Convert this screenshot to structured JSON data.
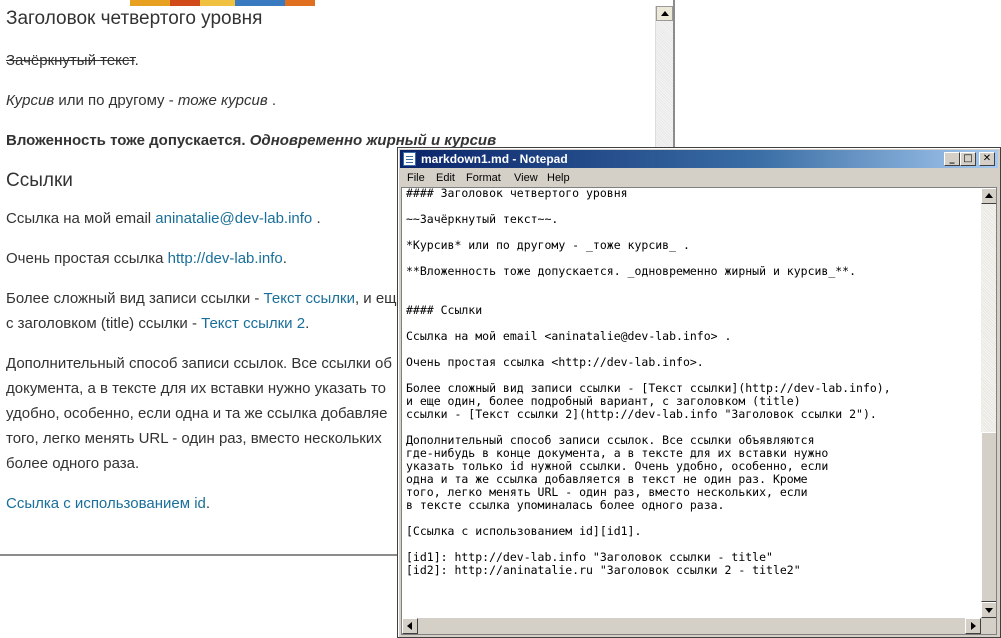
{
  "colors": {
    "link": "#1a6f9a",
    "text": "#333333",
    "titlebar_start": "#0a246a",
    "titlebar_end": "#a6caf0",
    "chrome": "#d4d0c8"
  },
  "preview": {
    "heading_h4": "Заголовок четвертого уровня",
    "strike_text": "Зачёркнутый текст",
    "strike_tail": ".",
    "italic_line": {
      "italic1": "Курсив",
      "middle": " или по другому - ",
      "italic2": "тоже курсив",
      "tail": " ."
    },
    "nested_line": {
      "bold": "Вложенность тоже допускается. ",
      "bold_italic": "Одновременно жирный и курсив"
    },
    "heading_links": "Ссылки",
    "email_line": {
      "prefix": "Ссылка на мой email ",
      "link": "aninatalie@dev-lab.info",
      "tail": " ."
    },
    "simple_link_line": {
      "prefix": "Очень простая ссылка ",
      "link": "http://dev-lab.info",
      "tail": "."
    },
    "complex_line1": {
      "prefix": "Более сложный вид записи ссылки - ",
      "link": "Текст ссылки",
      "tail": ", и ещ"
    },
    "complex_line2": {
      "prefix": "с заголовком (title) ссылки - ",
      "link": "Текст ссылки 2",
      "tail": "."
    },
    "extra_lines": [
      "Дополнительный способ записи ссылок. Все ссылки об",
      "документа, а в тексте для их вставки нужно указать то",
      "удобно, особенно, если одна и та же ссылка добавляе",
      "того, легко менять URL - один раз, вместо нескольких",
      "более одного раза."
    ],
    "id_link_line": {
      "link": "Ссылка с использованием id",
      "tail": "."
    }
  },
  "notepad": {
    "title": "markdown1.md - Notepad",
    "menu": [
      "File",
      "Edit",
      "Format",
      "View",
      "Help"
    ],
    "lines": [
      "#### Заголовок четвертого уровня",
      "",
      "~~Зачёркнутый текст~~.",
      "",
      "*Курсив* или по другому - _тоже курсив_ .",
      "",
      "**Вложенность тоже допускается. _одновременно жирный и курсив_**.",
      "",
      "",
      "#### Ссылки",
      "",
      "Ссылка на мой email <aninatalie@dev-lab.info> .",
      "",
      "Очень простая ссылка <http://dev-lab.info>.",
      "",
      "Более сложный вид записи ссылки - [Текст ссылки](http://dev-lab.info),",
      "и еще один, более подробный вариант, с заголовком (title)",
      "ссылки - [Текст ссылки 2](http://dev-lab.info \"Заголовок ссылки 2\").",
      "",
      "Дополнительный способ записи ссылок. Все ссылки объявляются",
      "где-нибудь в конце документа, а в тексте для их вставки нужно",
      "указать только id нужной ссылки. Очень удобно, особенно, если",
      "одна и та же ссылка добавляется в текст не один раз. Кроме",
      "того, легко менять URL - один раз, вместо нескольких, если",
      "в тексте ссылка упоминалась более одного раза.",
      "",
      "[Ссылка с использованием id][id1].",
      "",
      "[id1]: http://dev-lab.info \"Заголовок ссылки - title\"",
      "[id2]: http://aninatalie.ru \"Заголовок ссылки 2 - title2\""
    ]
  }
}
